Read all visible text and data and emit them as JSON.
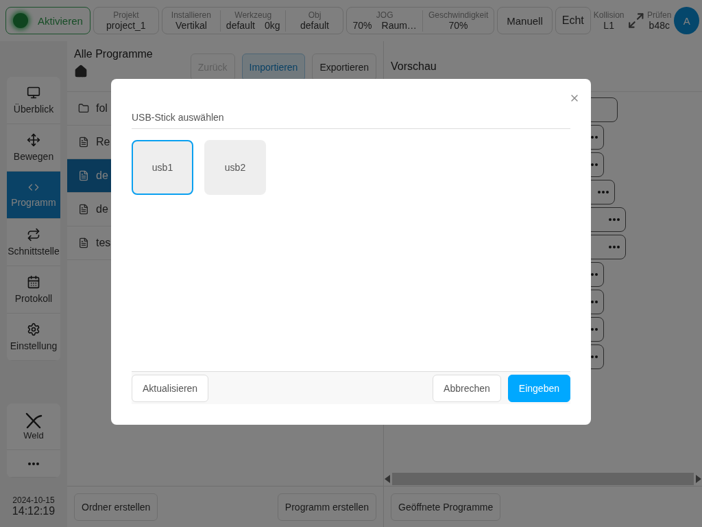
{
  "top_bar": {
    "activate": {
      "label": "Aktivieren",
      "on": true
    },
    "project": {
      "label": "Projekt",
      "value": "project_1"
    },
    "groups": [
      [
        {
          "label": "Installieren",
          "values": [
            "Vertikal"
          ]
        },
        {
          "label": "Werkzeug",
          "values": [
            "default",
            "0kg"
          ]
        },
        {
          "label": "Obj",
          "values": [
            "default"
          ]
        }
      ],
      [
        {
          "label": "JOG",
          "values": [
            "70%",
            "Raum…"
          ]
        },
        {
          "label": "Geschwindigkeit",
          "values": [
            "70%"
          ]
        }
      ]
    ],
    "mode_buttons": [
      "Manuell",
      "Echt"
    ],
    "collision": {
      "label": "Kollision",
      "value": "L1"
    },
    "check": {
      "label": "Prüfen",
      "value": "b48c"
    },
    "avatar": "A"
  },
  "sidebar": {
    "items": [
      {
        "label": "Überblick",
        "kind": "monitor",
        "selected": false
      },
      {
        "label": "Bewegen",
        "kind": "move",
        "selected": false
      },
      {
        "label": "Programm",
        "kind": "code",
        "selected": true
      },
      {
        "label": "Schnittstelle",
        "kind": "repeat",
        "selected": false
      },
      {
        "label": "Protokoll",
        "kind": "calendar",
        "selected": false
      },
      {
        "label": "Einstellung",
        "kind": "gear",
        "selected": false
      }
    ],
    "extra": [
      {
        "label": "Weld",
        "kind": "weld"
      },
      {
        "kind": "more"
      }
    ],
    "date": "2024-10-15",
    "time": "14:12:19"
  },
  "programs": {
    "title": "Alle Programme",
    "buttons": [
      {
        "label": "Zurück",
        "disabled": true,
        "primary": false
      },
      {
        "label": "Importieren",
        "disabled": false,
        "primary": true
      },
      {
        "label": "Exportieren",
        "disabled": false,
        "primary": false
      }
    ],
    "items": [
      {
        "name": "fol",
        "kind": "folder",
        "selected": false
      },
      {
        "name": "Re",
        "kind": "file",
        "selected": false
      },
      {
        "name": "de",
        "kind": "file",
        "selected": true
      },
      {
        "name": "de",
        "kind": "file",
        "selected": false
      },
      {
        "name": "tes",
        "kind": "file",
        "selected": false
      }
    ],
    "footer": [
      "Ordner erstellen",
      "Programm erstellen"
    ]
  },
  "preview": {
    "title": "Vorschau",
    "nodes": [
      {
        "menu": false
      },
      {
        "menu": true
      },
      {
        "menu": true
      },
      {
        "menu": true
      },
      {
        "menu": true
      },
      {
        "menu": true
      },
      {
        "menu": true
      },
      {
        "menu": true
      },
      {
        "menu": true
      },
      {
        "menu": true
      }
    ],
    "footer": "Geöffnete Programme"
  },
  "dialog": {
    "title": "USB-Stick auswählen",
    "devices": [
      {
        "name": "usb1",
        "selected": true
      },
      {
        "name": "usb2",
        "selected": false
      }
    ],
    "refresh": "Aktualisieren",
    "cancel": "Abbrechen",
    "confirm": "Eingeben"
  }
}
